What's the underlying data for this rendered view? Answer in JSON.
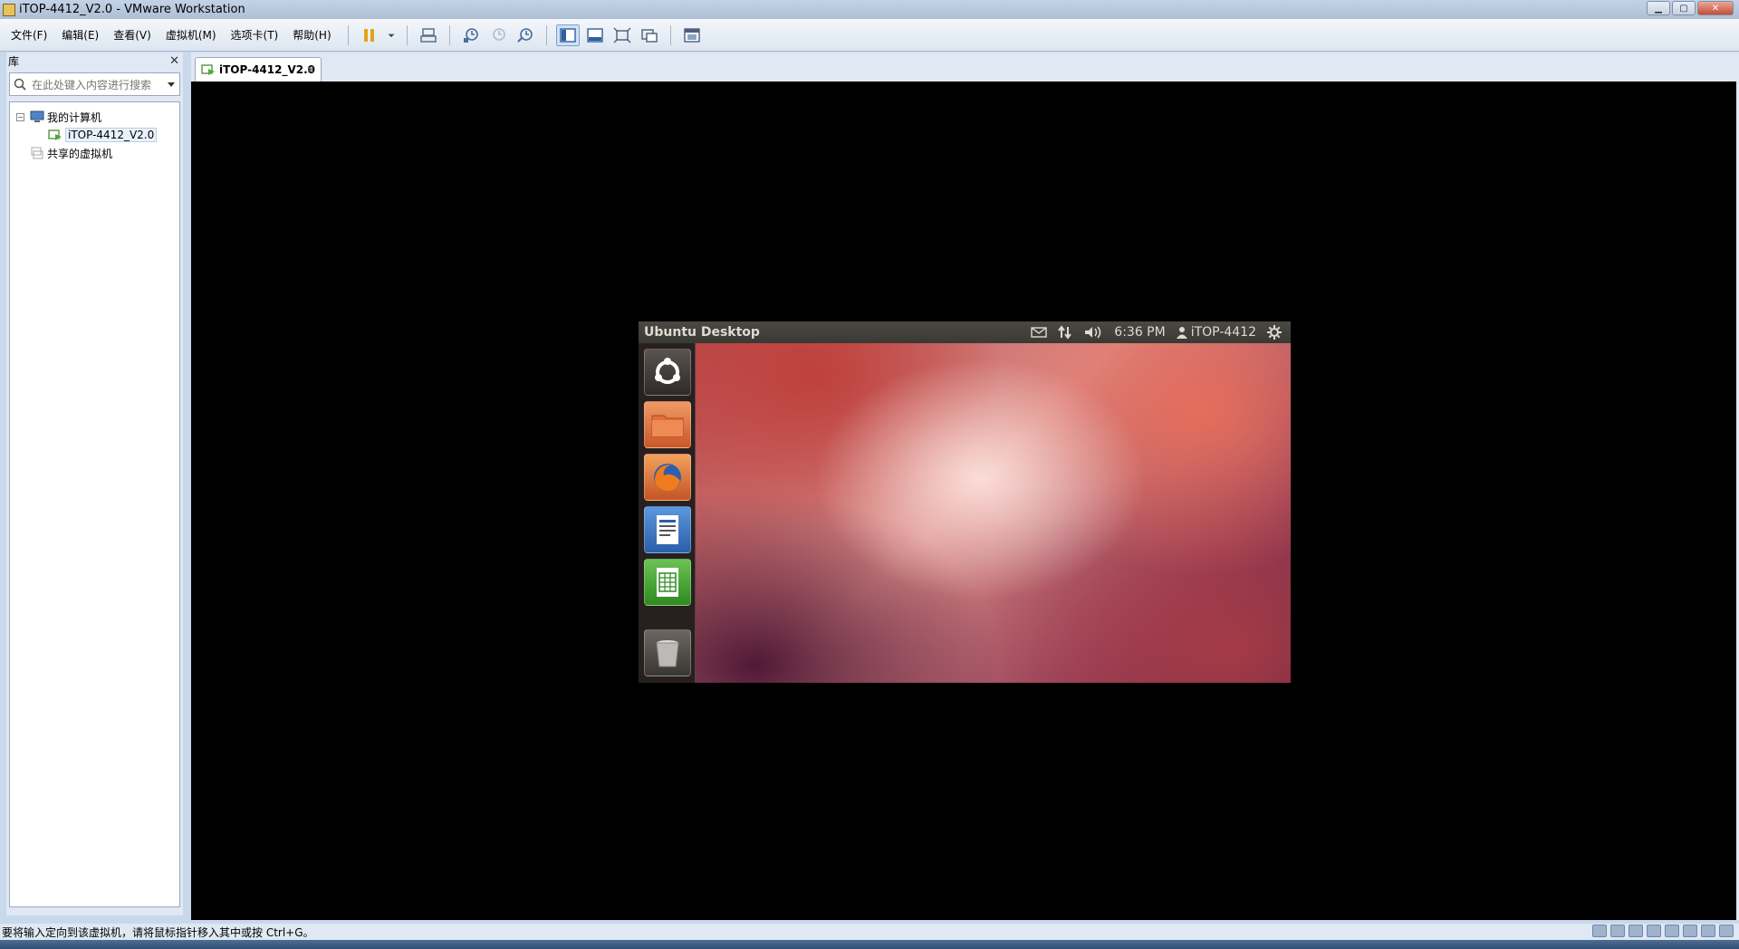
{
  "window": {
    "title": "iTOP-4412_V2.0 - VMware Workstation"
  },
  "menu": [
    {
      "label": "文件(F)"
    },
    {
      "label": "编辑(E)"
    },
    {
      "label": "查看(V)"
    },
    {
      "label": "虚拟机(M)"
    },
    {
      "label": "选项卡(T)"
    },
    {
      "label": "帮助(H)"
    }
  ],
  "toolbar": {
    "icons": [
      "pause-icon",
      "dropdown-arrow-icon",
      "send-ctrl-alt-del-icon",
      "snapshot-icon",
      "revert-snapshot-icon",
      "snapshot-manager-icon",
      "show-library-icon",
      "thumbnail-bar-icon",
      "fullscreen-icon",
      "unity-icon",
      "console-view-icon"
    ]
  },
  "sidebar": {
    "title": "库",
    "close_label": "✕",
    "search_placeholder": "在此处键入内容进行搜索",
    "tree": [
      {
        "label": "我的计算机",
        "expander": "−",
        "level": 0
      },
      {
        "label": "iTOP-4412_V2.0",
        "level": 1,
        "selected": true
      },
      {
        "label": "共享的虚拟机",
        "level": 0
      }
    ]
  },
  "tabs": [
    {
      "label": "iTOP-4412_V2.0",
      "close": "✕"
    }
  ],
  "guest": {
    "panel_title": "Ubuntu Desktop",
    "time": "6:36 PM",
    "user": "iTOP-4412",
    "launcher": [
      "dash-home-icon",
      "files-folder-icon",
      "firefox-icon",
      "libreoffice-writer-icon",
      "libreoffice-calc-icon",
      "trash-icon"
    ]
  },
  "status": {
    "message": "要将输入定向到该虚拟机，请将鼠标指针移入其中或按 Ctrl+G。"
  },
  "colors": {
    "vm_background": "#000000",
    "chrome": "#dfe8f3",
    "ubuntu_panel": "#3b3934"
  }
}
